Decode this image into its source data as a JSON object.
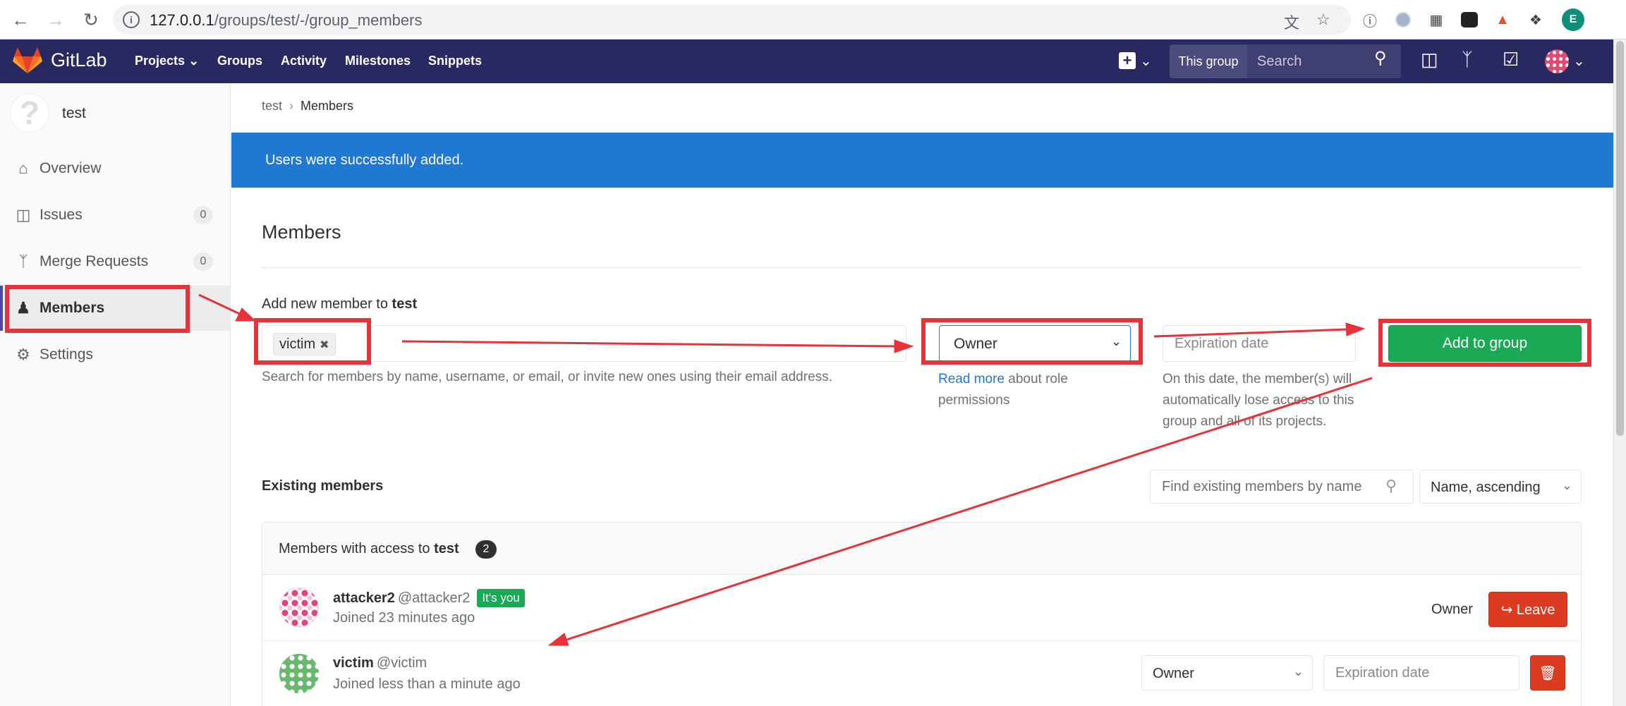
{
  "browser": {
    "url_host": "127.0.0.1",
    "url_path": "/groups/test/-/group_members",
    "profile_initial": "E"
  },
  "navbar": {
    "brand": "GitLab",
    "links": [
      "Projects",
      "Groups",
      "Activity",
      "Milestones",
      "Snippets"
    ],
    "search_scope": "This group",
    "search_placeholder": "Search"
  },
  "sidebar": {
    "group_name": "test",
    "items": [
      {
        "label": "Overview",
        "icon": "home-icon"
      },
      {
        "label": "Issues",
        "icon": "issues-icon",
        "count": "0"
      },
      {
        "label": "Merge Requests",
        "icon": "merge-request-icon",
        "count": "0"
      },
      {
        "label": "Members",
        "icon": "users-icon",
        "active": true
      },
      {
        "label": "Settings",
        "icon": "gear-icon"
      }
    ]
  },
  "breadcrumb": [
    "test",
    "Members"
  ],
  "flash": "Users were successfully added.",
  "page_title": "Members",
  "add_member": {
    "label": "Add new member to",
    "group": "test",
    "token": "victim",
    "help": "Search for members by name, username, or email, or invite new ones using their email address.",
    "role": "Owner",
    "read_more_link": "Read more",
    "read_more_rest": "about role permissions",
    "expiration_placeholder": "Expiration date",
    "expiration_help": "On this date, the member(s) will automatically lose access to this group and all of its projects.",
    "submit": "Add to group"
  },
  "existing": {
    "label": "Existing members",
    "find_placeholder": "Find existing members by name",
    "sort": "Name, ascending",
    "panel_title": "Members with access to",
    "panel_group": "test",
    "count": "2",
    "members": [
      {
        "name": "attacker2",
        "username": "@attacker2",
        "badge": "It's you",
        "joined": "Joined 23 minutes ago",
        "role": "Owner",
        "action": "Leave"
      },
      {
        "name": "victim",
        "username": "@victim",
        "joined": "Joined less than a minute ago",
        "role": "Owner",
        "expiration_placeholder": "Expiration date"
      }
    ]
  },
  "colors": {
    "navbar": "#292961",
    "flash": "#1f78d1",
    "success": "#1aaa55",
    "danger": "#db3b21",
    "annotation": "#e8323a"
  }
}
